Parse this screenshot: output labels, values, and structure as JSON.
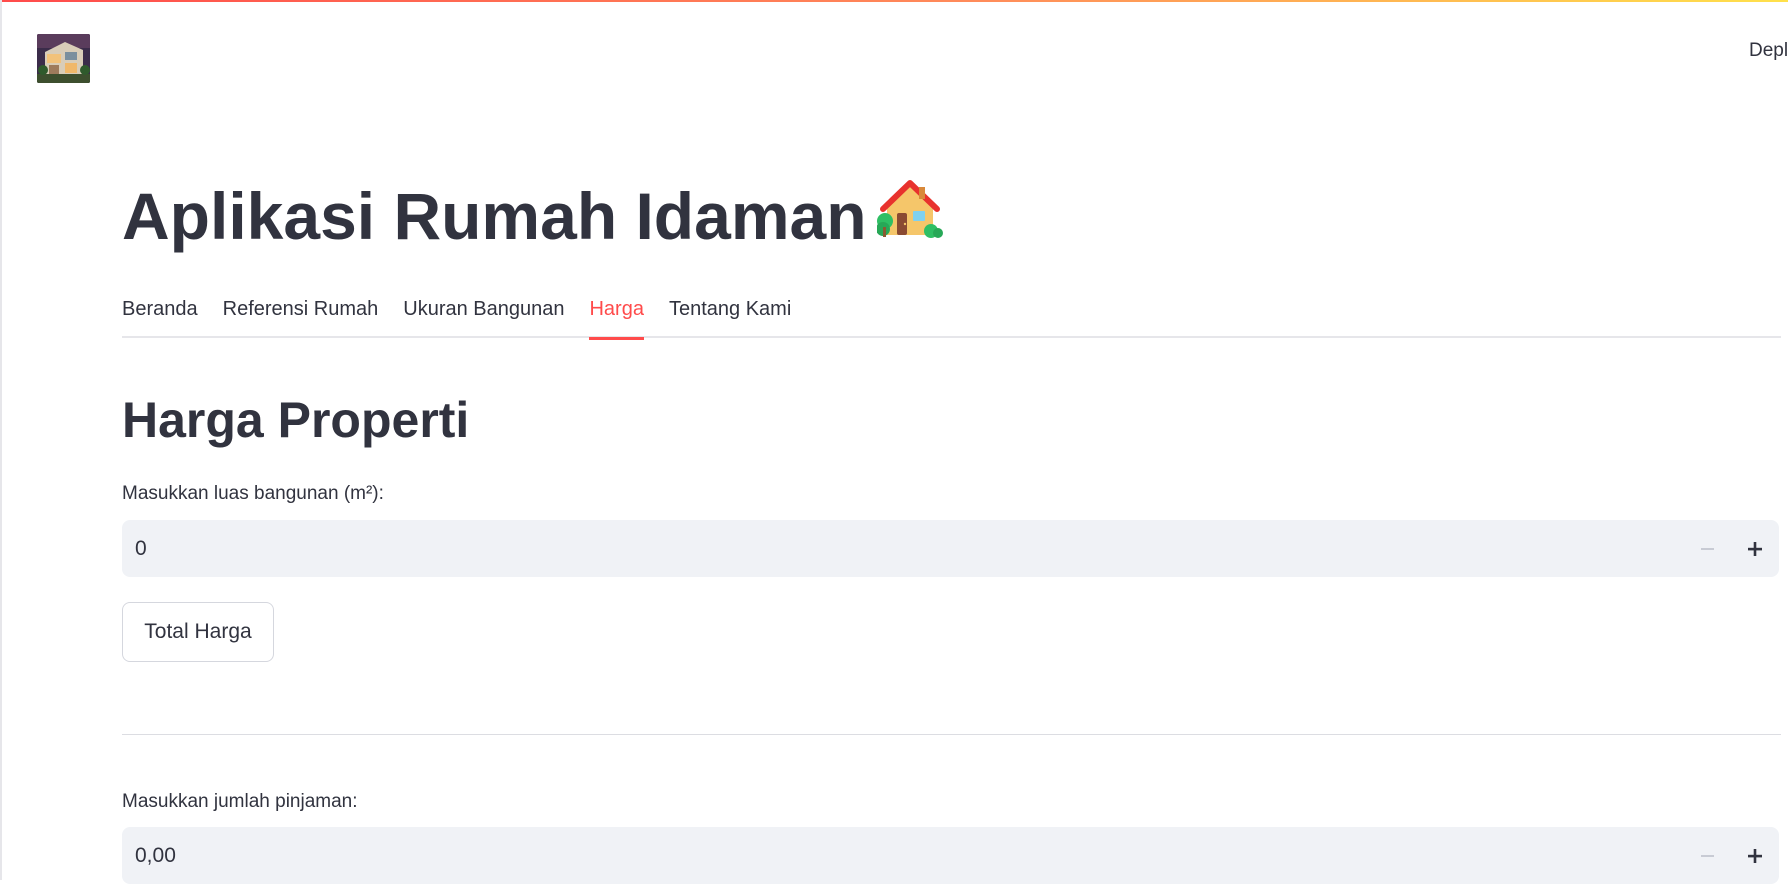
{
  "header": {
    "logo_alt": "house photo logo",
    "deploy_label": "Depl"
  },
  "title": {
    "text": "Aplikasi Rumah Idaman",
    "emoji_icon": "house-with-garden-icon"
  },
  "tabs": [
    {
      "label": "Beranda",
      "active": false
    },
    {
      "label": "Referensi Rumah",
      "active": false
    },
    {
      "label": "Ukuran Bangunan",
      "active": false
    },
    {
      "label": "Harga",
      "active": true
    },
    {
      "label": "Tentang Kami",
      "active": false
    }
  ],
  "section": {
    "heading": "Harga Properti"
  },
  "building_area": {
    "label": "Masukkan luas bangunan (m²):",
    "value": "0"
  },
  "total_button": {
    "label": "Total Harga"
  },
  "loan": {
    "label": "Masukkan jumlah pinjaman:",
    "value": "0,00"
  },
  "colors": {
    "accent": "#ff4b4b",
    "text": "#31333f",
    "input_bg": "#f0f2f6"
  }
}
